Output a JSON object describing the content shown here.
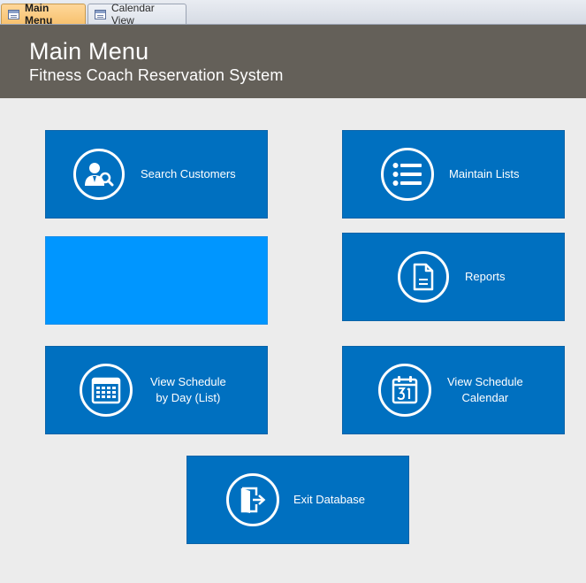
{
  "tabs": [
    {
      "label": "Main Menu",
      "active": true,
      "icon": "form-icon"
    },
    {
      "label": "Calendar View",
      "active": false,
      "icon": "form-icon"
    }
  ],
  "header": {
    "title": "Main Menu",
    "subtitle": "Fitness Coach Reservation System"
  },
  "tiles": {
    "search": {
      "label": "Search Customers",
      "icon": "search-customer-icon"
    },
    "blank": {
      "label": ""
    },
    "lists": {
      "label": "Maintain Lists",
      "icon": "list-icon"
    },
    "reports": {
      "label": "Reports",
      "icon": "document-icon"
    },
    "day": {
      "label": "View Schedule\nby Day (List)",
      "icon": "calendar-grid-icon"
    },
    "cal": {
      "label": "View Schedule\nCalendar",
      "icon": "calendar-31-icon"
    },
    "exit": {
      "label": "Exit Database",
      "icon": "exit-door-icon"
    }
  },
  "colors": {
    "tile": "#0070c0",
    "tile_blank": "#0096ff",
    "header": "#646059",
    "background": "#ececec",
    "active_tab": "#f7c26f"
  }
}
